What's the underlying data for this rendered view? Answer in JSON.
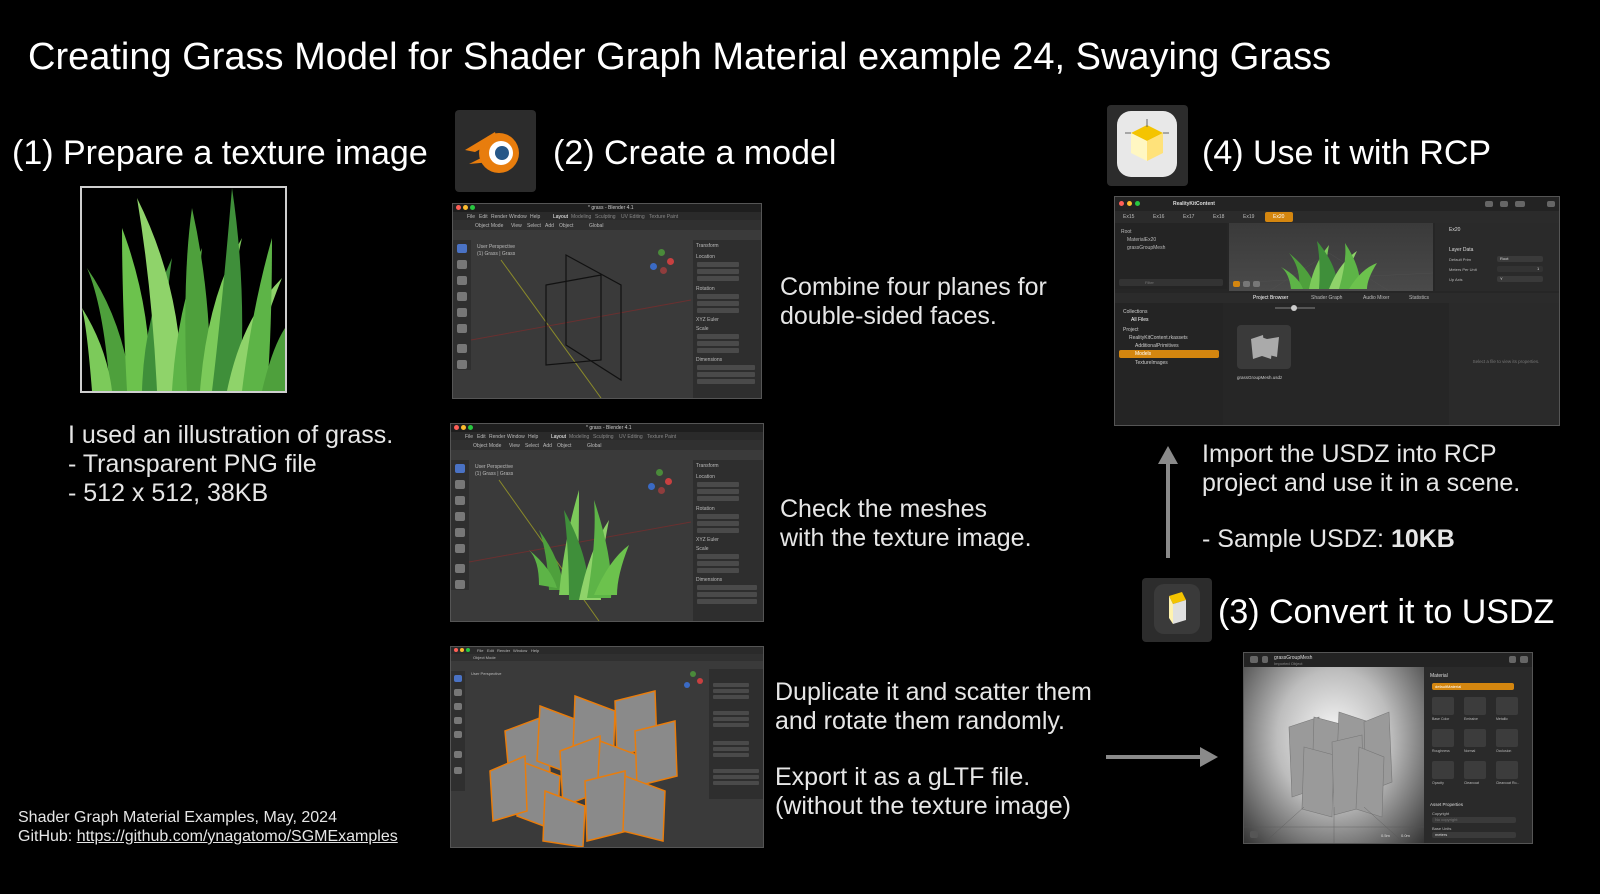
{
  "title": "Creating Grass Model for Shader Graph Material example 24, Swaying Grass",
  "step1": {
    "heading": "(1) Prepare a texture image",
    "desc": [
      "I used an illustration of grass.",
      "- Transparent PNG file",
      "- 512 x 512, 38KB"
    ]
  },
  "step2": {
    "heading": "(2) Create a model",
    "blender_title": "* grass - Blender 4.1",
    "viewport_label": [
      "User Perspective",
      "(1) Grass | Grass"
    ],
    "menu": [
      "File",
      "Edit",
      "Render",
      "Window",
      "Help"
    ],
    "workspace_tabs": [
      "Layout",
      "Modeling",
      "Sculpting",
      "UV Editing",
      "Texture Paint"
    ],
    "header_items": [
      "Object Mode",
      "View",
      "Select",
      "Add",
      "Object",
      "Global"
    ],
    "transform_labels": [
      "Transform",
      "Location",
      "Rotation",
      "XYZ Euler",
      "Scale",
      "Dimensions"
    ],
    "shots": [
      {
        "caption": [
          "Combine four planes for",
          "double-sided faces."
        ]
      },
      {
        "caption": [
          "Check the meshes",
          "with the texture image."
        ]
      },
      {
        "caption": [
          "Duplicate it and scatter them",
          "and rotate them randomly.",
          "",
          "Export it as a gLTF file.",
          "(without the texture image)"
        ]
      }
    ]
  },
  "step3": {
    "heading": "(3) Convert it to USDZ",
    "window_title": "grassGroupMesh",
    "window_subtitle": "Imported Object",
    "material_section": "Material",
    "material_value": "defaultMaterial",
    "texture_slots": [
      "Base Color",
      "Emissive",
      "Metallic",
      "Roughness",
      "Normal",
      "Occlusion",
      "Opacity",
      "Clearcoat",
      "Clearcoat Ro..."
    ],
    "asset_section": "Asset Properties",
    "copyright_label": "Copyright",
    "copyright_placeholder": "No copyright",
    "base_units_label": "Base Units",
    "base_units_value": "meters",
    "scale_labels": [
      "0.5m",
      "0.0m"
    ]
  },
  "step4": {
    "heading": "(4) Use it with RCP",
    "app_title": "RealityKitContent",
    "tabs": [
      "Ex15",
      "Ex16",
      "Ex17",
      "Ex18",
      "Ex19",
      "Ex20"
    ],
    "active_tab": "Ex20",
    "tree": [
      "Root",
      "MaterialEx20",
      "grassGroupMesh"
    ],
    "filter_placeholder": "Filter",
    "inspector_title": "Ex20",
    "layer_data": "Layer Data",
    "layer_rows": [
      {
        "label": "Default Prim",
        "value": "Root"
      },
      {
        "label": "Meters Per Unit",
        "value": "1"
      },
      {
        "label": "Up Axis",
        "value": "Y"
      }
    ],
    "bottom_tabs": [
      "Project Browser",
      "Shader Graph",
      "Audio Mixer",
      "Statistics"
    ],
    "collections_label": "Collections",
    "all_files": "All Files",
    "project_label": "Project",
    "project_items": [
      "RealityKitContent.rkassets",
      "AdditionalPrimitives",
      "Models",
      "TextureImages"
    ],
    "selected_folder": "Models",
    "asset_file": "grassGroupMesh.usdz",
    "empty_inspector": "Select a file to view its properties.",
    "desc": [
      "Import the USDZ into RCP",
      "project and use it in a scene."
    ],
    "sample_prefix": "- Sample USDZ: ",
    "sample_size": "10KB"
  },
  "footer": {
    "line1": "Shader Graph Material Examples, May, 2024",
    "github_label": "GitHub: ",
    "github_link": "https://github.com/ynagatomo/SGMExamples"
  },
  "colors": {
    "background": "#000000",
    "blender_orange": "#e87d0d",
    "blender_blue": "#265787",
    "rcp_yellow": "#f4c400",
    "selection_orange": "#d4860f",
    "grass_light": "#8fd36a",
    "grass_dark": "#3f8f3a"
  }
}
